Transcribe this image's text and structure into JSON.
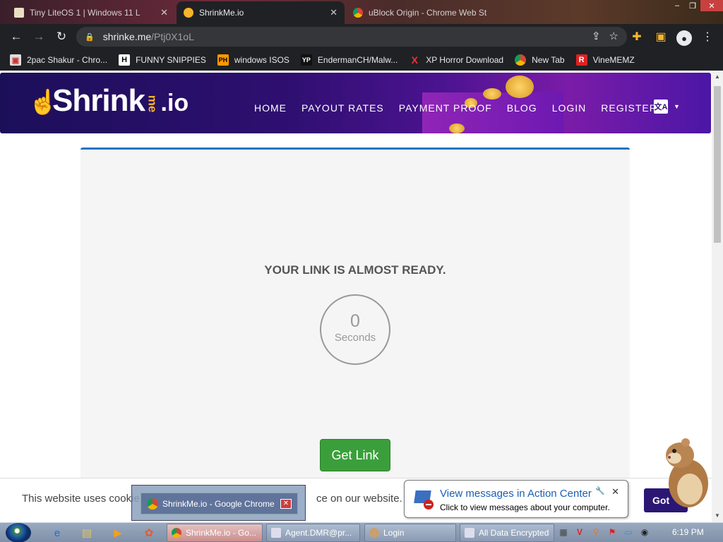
{
  "browser": {
    "tabs": [
      {
        "title": "Tiny LiteOS 1 | Windows 11 L",
        "active": false
      },
      {
        "title": "ShrinkMe.io",
        "active": true
      },
      {
        "title": "uBlock Origin - Chrome Web St",
        "active": false
      }
    ],
    "url_host": "shrinke.me",
    "url_path": "/Ptj0X1oL",
    "bookmarks": [
      {
        "label": "2pac Shakur - Chro...",
        "icon": "2pac-icon"
      },
      {
        "label": "FUNNY SNIPPIES",
        "icon": "H"
      },
      {
        "label": "windows ISOS",
        "icon": "PH"
      },
      {
        "label": "EndermanCH/Malw...",
        "icon": "YP"
      },
      {
        "label": "XP Horror Download",
        "icon": "X"
      },
      {
        "label": "New Tab",
        "icon": "chrome-icon"
      },
      {
        "label": "VineMEMZ",
        "icon": "R"
      }
    ]
  },
  "site": {
    "logo_main": "Shrink",
    "logo_me": "me",
    "logo_tld": ".io",
    "nav": [
      "HOME",
      "PAYOUT RATES",
      "PAYMENT PROOF",
      "BLOG",
      "LOGIN",
      "REGISTER"
    ],
    "colors": {
      "accent": "#1f74c8",
      "button": "#3a9f3a",
      "header": "#2e0f70"
    }
  },
  "main": {
    "heading": "YOUR LINK IS ALMOST READY.",
    "countdown_value": "0",
    "countdown_unit": "Seconds",
    "button_label": "Get Link"
  },
  "cookie": {
    "text_start": "This website uses cookie",
    "text_end": "ce on our website.",
    "button_label": "Got"
  },
  "notification": {
    "title": "View messages in Action Center",
    "subtitle": "Click to view messages about your computer."
  },
  "preview": {
    "title": "ShrinkMe.io - Google Chrome"
  },
  "taskbar": {
    "buttons": [
      {
        "label": "ShrinkMe.io - Go...",
        "active": true
      },
      {
        "label": "Agent.DMR@pr...",
        "active": false
      },
      {
        "label": "Login",
        "active": false
      },
      {
        "label": "All Data Encrypted",
        "active": false
      }
    ],
    "clock": "6:19 PM"
  }
}
